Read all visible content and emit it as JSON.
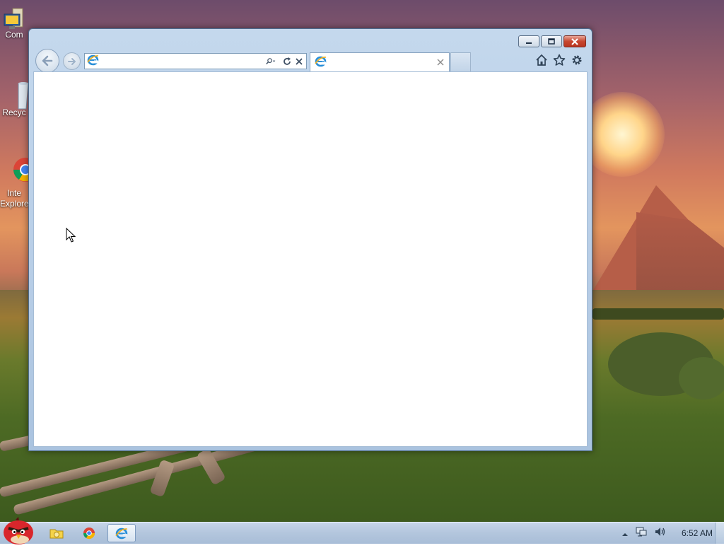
{
  "desktop": {
    "icons": [
      {
        "label": "Com",
        "icon": "computer-icon"
      },
      {
        "label": "Recyc",
        "icon": "recycle-bin-icon"
      },
      {
        "label": "Inte\nExplore",
        "icon": "chrome-icon"
      }
    ]
  },
  "window": {
    "title": "",
    "address_value": "",
    "tab_title": "",
    "buttons": {
      "minimize": "minimize-icon",
      "maximize": "maximize-icon",
      "close": "close-icon"
    }
  },
  "taskbar": {
    "items": [
      "start-orb-icon",
      "file-explorer-icon",
      "chrome-icon",
      "internet-explorer-icon"
    ],
    "tray_icons": [
      "show-hidden-icons-arrow",
      "network-icon",
      "volume-icon"
    ],
    "clock": "6:52 AM"
  },
  "colors": {
    "window_frame": "#b7cde6",
    "close_button": "#c7462f",
    "taskbar": "#b3c6dd",
    "content_bg": "#ffffff"
  }
}
